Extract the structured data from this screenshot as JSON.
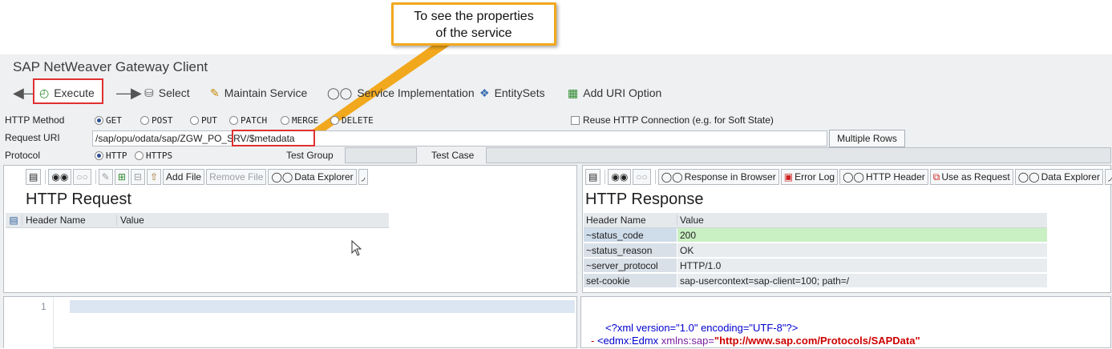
{
  "callout": {
    "line1": "To see the properties",
    "line2": "of the service"
  },
  "app": {
    "title": "SAP NetWeaver Gateway Client"
  },
  "toolbar": {
    "execute": "Execute",
    "select": "Select",
    "maintain_service": "Maintain Service",
    "service_implementation": "Service Implementation",
    "entitysets": "EntitySets",
    "add_uri_option": "Add URI Option"
  },
  "form": {
    "http_method_label": "HTTP Method",
    "methods": [
      "GET",
      "POST",
      "PUT",
      "PATCH",
      "MERGE",
      "DELETE"
    ],
    "selected_method": "GET",
    "reuse_label": "Reuse HTTP Connection (e.g. for Soft State)",
    "request_uri_label": "Request URI",
    "request_uri": "/sap/opu/odata/sap/ZGW_PO_SRV/$metadata",
    "multiple_rows": "Multiple Rows",
    "protocol_label": "Protocol",
    "protocols": [
      "HTTP",
      "HTTPS"
    ],
    "selected_protocol": "HTTP",
    "test_group_label": "Test Group",
    "test_case_label": "Test Case"
  },
  "request": {
    "toolbar": {
      "add_file": "Add File",
      "remove_file": "Remove File",
      "data_explorer": "Data Explorer"
    },
    "title": "HTTP Request",
    "col_name": "Header Name",
    "col_value": "Value",
    "editor_line": "1"
  },
  "response": {
    "toolbar": {
      "response_in_browser": "Response in Browser",
      "error_log": "Error Log",
      "http_header": "HTTP Header",
      "use_as_request": "Use as Request",
      "data_explorer": "Data Explorer"
    },
    "title": "HTTP Response",
    "col_name": "Header Name",
    "col_value": "Value",
    "rows": [
      {
        "name": "~status_code",
        "value": "200"
      },
      {
        "name": "~status_reason",
        "value": "OK"
      },
      {
        "name": "~server_protocol",
        "value": "HTTP/1.0"
      },
      {
        "name": "set-cookie",
        "value": "sap-usercontext=sap-client=100; path=/"
      }
    ],
    "xml": {
      "line1": "<?xml version=\"1.0\" encoding=\"UTF-8\"?>",
      "line2_prefix": "- ",
      "line2_tag": "<edmx:Edmx ",
      "line2_attr": "xmlns:sap=",
      "line2_value": "\"http://www.sap.com/Protocols/SAPData\""
    }
  },
  "colors": {
    "accent_red": "#e03030",
    "callout_orange": "#f2a81d",
    "status_green": "#c9f0c3"
  }
}
